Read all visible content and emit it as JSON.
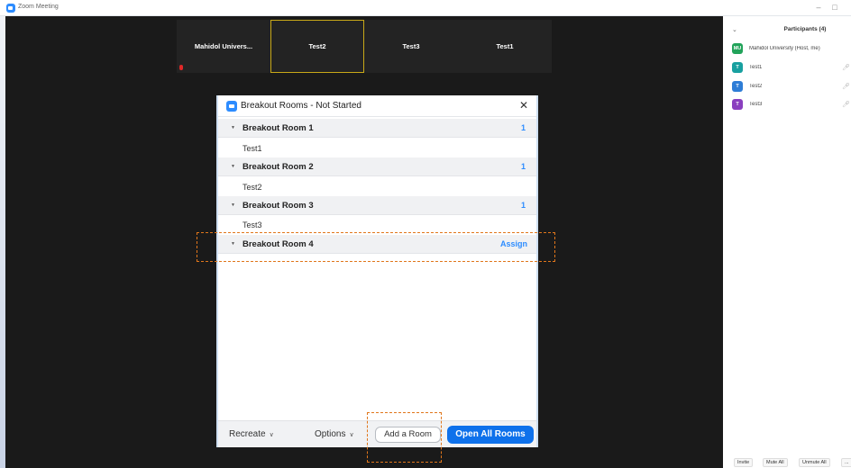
{
  "window": {
    "title": "Zoom Meeting",
    "minimize_glyph": "–",
    "maximize_glyph": "□"
  },
  "video_tiles": [
    {
      "name": "Mahidol Univers...",
      "muted": true
    },
    {
      "name": "Test2",
      "active": true
    },
    {
      "name": "Test3"
    },
    {
      "name": "Test1"
    }
  ],
  "participants": {
    "collapse_glyph": "⌄",
    "title": "Participants (4)",
    "list": [
      {
        "initials": "MU",
        "name": "Mahidol University (Host, me)",
        "color": "#22a35a",
        "mic": ""
      },
      {
        "initials": "T",
        "name": "Test1",
        "color": "#18a0a0",
        "mic": "🎙"
      },
      {
        "initials": "T",
        "name": "Test2",
        "color": "#2e7dd6",
        "mic": "🎙"
      },
      {
        "initials": "T",
        "name": "Test3",
        "color": "#8a3fbf",
        "mic": "🎙"
      }
    ],
    "footer": {
      "invite": "Invite",
      "mute_all": "Mute All",
      "unmute_all": "Unmute All",
      "more": "..."
    }
  },
  "dialog": {
    "title": "Breakout Rooms - Not Started",
    "close_glyph": "✕",
    "rooms": [
      {
        "name": "Breakout Room 1",
        "count": "1",
        "members": [
          "Test1"
        ]
      },
      {
        "name": "Breakout Room 2",
        "count": "1",
        "members": [
          "Test2"
        ]
      },
      {
        "name": "Breakout Room 3",
        "count": "1",
        "members": [
          "Test3"
        ]
      },
      {
        "name": "Breakout Room 4",
        "assign": "Assign",
        "members": []
      }
    ],
    "footer": {
      "recreate": "Recreate",
      "options": "Options",
      "add_room": "Add a Room",
      "open_all": "Open All Rooms"
    }
  },
  "colors": {
    "accent": "#0e71eb",
    "link": "#2d8cff",
    "highlight": "#e0761b"
  }
}
